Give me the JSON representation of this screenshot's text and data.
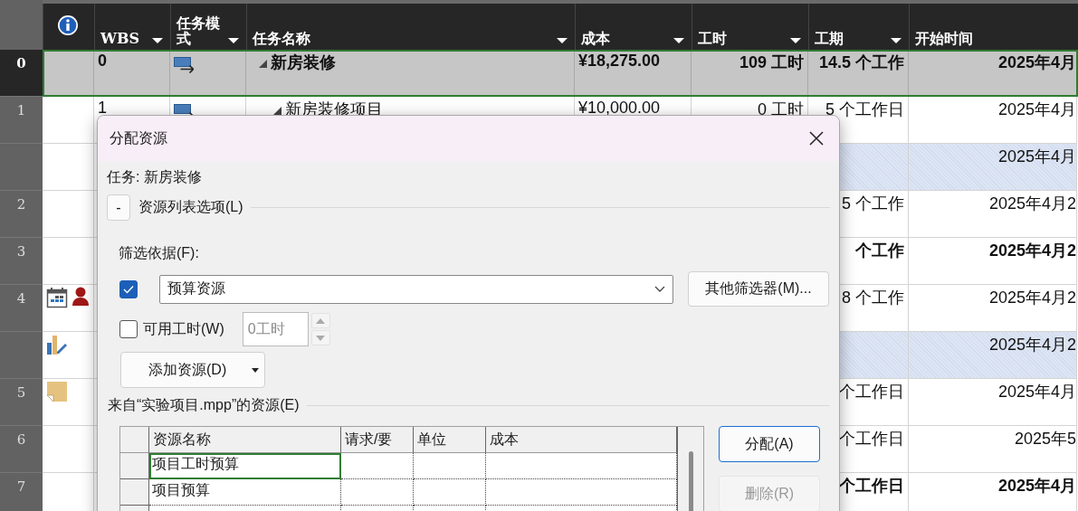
{
  "sheet": {
    "columns": [
      {
        "kind": "info",
        "filter": false
      },
      {
        "kind": "text",
        "label": "WBS",
        "filter": true
      },
      {
        "kind": "text",
        "label": "任务模式",
        "filter": true
      },
      {
        "kind": "text",
        "label": "任务名称",
        "filter": true
      },
      {
        "kind": "text",
        "label": "成本",
        "filter": true
      },
      {
        "kind": "text",
        "label": "工时",
        "filter": true
      },
      {
        "kind": "text",
        "label": "工期",
        "filter": true
      },
      {
        "kind": "text",
        "label": "开始时间",
        "filter": false
      }
    ],
    "rows": [
      {
        "number": "0",
        "selected": true,
        "summary": true,
        "shaded": false,
        "expanded": true,
        "mode": {
          "kind": "auto"
        },
        "wbs": "0",
        "name": "新房装修",
        "cost": "¥18,275.00",
        "work": "109 工时",
        "duration": "14.5 个工作",
        "start": "2025年4月",
        "children": [
          {
            "number": "1",
            "selected": false,
            "summary": false,
            "shaded": false,
            "expanded": true,
            "mode": {
              "kind": "auto"
            },
            "wbs": "1",
            "name": "新房装修项目",
            "cost": "¥10,000.00",
            "work": "0 工时",
            "duration": "5 个工作日",
            "start": "2025年4月"
          },
          {
            "selected": false,
            "summary": false,
            "shaded": true,
            "start": "2025年4月"
          },
          {
            "number": "2",
            "selected": false,
            "summary": false,
            "shaded": false,
            "duration": "5 个工作",
            "start": "2025年4月2"
          },
          {
            "number": "3",
            "selected": false,
            "summary": true,
            "shaded": false,
            "duration": "个工作",
            "start": "2025年4月2"
          },
          {
            "number": "4",
            "selected": false,
            "summary": false,
            "shaded": false,
            "indicators": [
              {
                "kind": "calendar"
              },
              {
                "kind": "person"
              }
            ],
            "duration": "8 个工作",
            "start": "2025年4月2"
          },
          {
            "selected": false,
            "summary": false,
            "shaded": true,
            "indicators": [
              {
                "kind": "chart-edit"
              }
            ],
            "start": "2025年4月2"
          },
          {
            "number": "5",
            "selected": false,
            "summary": false,
            "shaded": false,
            "indicators": [
              {
                "kind": "note"
              }
            ],
            "duration": "个工作日",
            "start": "2025年4月"
          },
          {
            "number": "6",
            "selected": false,
            "summary": false,
            "shaded": false,
            "duration": "个工作日",
            "start": "2025年5"
          },
          {
            "number": "7",
            "selected": false,
            "summary": true,
            "shaded": false,
            "duration": "个工作日",
            "start": "2025年4月"
          }
        ]
      }
    ]
  },
  "dialog": {
    "title": "分配资源",
    "task_label": "任务: 新房装修",
    "options_toggle": "-",
    "options_label": "资源列表选项(L)",
    "filter_label": "筛选依据(F):",
    "filter": {
      "checked": true,
      "value": "预算资源"
    },
    "more_filters": "其他筛选器(M)...",
    "available_work": {
      "checked": false,
      "label": "可用工时(W)",
      "value": "0工时",
      "disabled": true
    },
    "add_button": "添加资源(D)",
    "resources_label": "来自“实验项目.mpp”的资源(E)",
    "resources": {
      "columns": [
        "资源名称",
        "请求/要",
        "单位",
        "成本"
      ],
      "rows": [
        {
          "name": "项目工时预算",
          "selected": true
        },
        {
          "name": "项目预算",
          "selected": false
        },
        {
          "selected": false
        }
      ]
    },
    "buttons": [
      {
        "label": "分配(A)",
        "default": true,
        "disabled": false
      },
      {
        "label": "删除(R)",
        "default": false,
        "disabled": true
      }
    ]
  }
}
